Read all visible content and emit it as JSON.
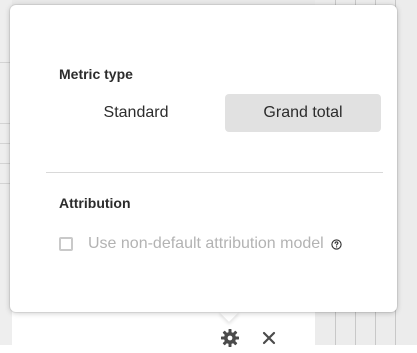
{
  "metric_type": {
    "label": "Metric type",
    "options": [
      {
        "label": "Standard",
        "selected": false
      },
      {
        "label": "Grand total",
        "selected": true
      }
    ]
  },
  "attribution": {
    "label": "Attribution",
    "checkbox_label": "Use non-default attribution model",
    "checked": false,
    "disabled": true,
    "help_icon": "help-circle-icon"
  },
  "toolbar": {
    "gear_icon": "gear-icon",
    "close_icon": "close-icon"
  },
  "colors": {
    "selected_option_bg": "#e1e1e1",
    "text": "#2c2c2c",
    "disabled_text": "#b3b3b3"
  }
}
